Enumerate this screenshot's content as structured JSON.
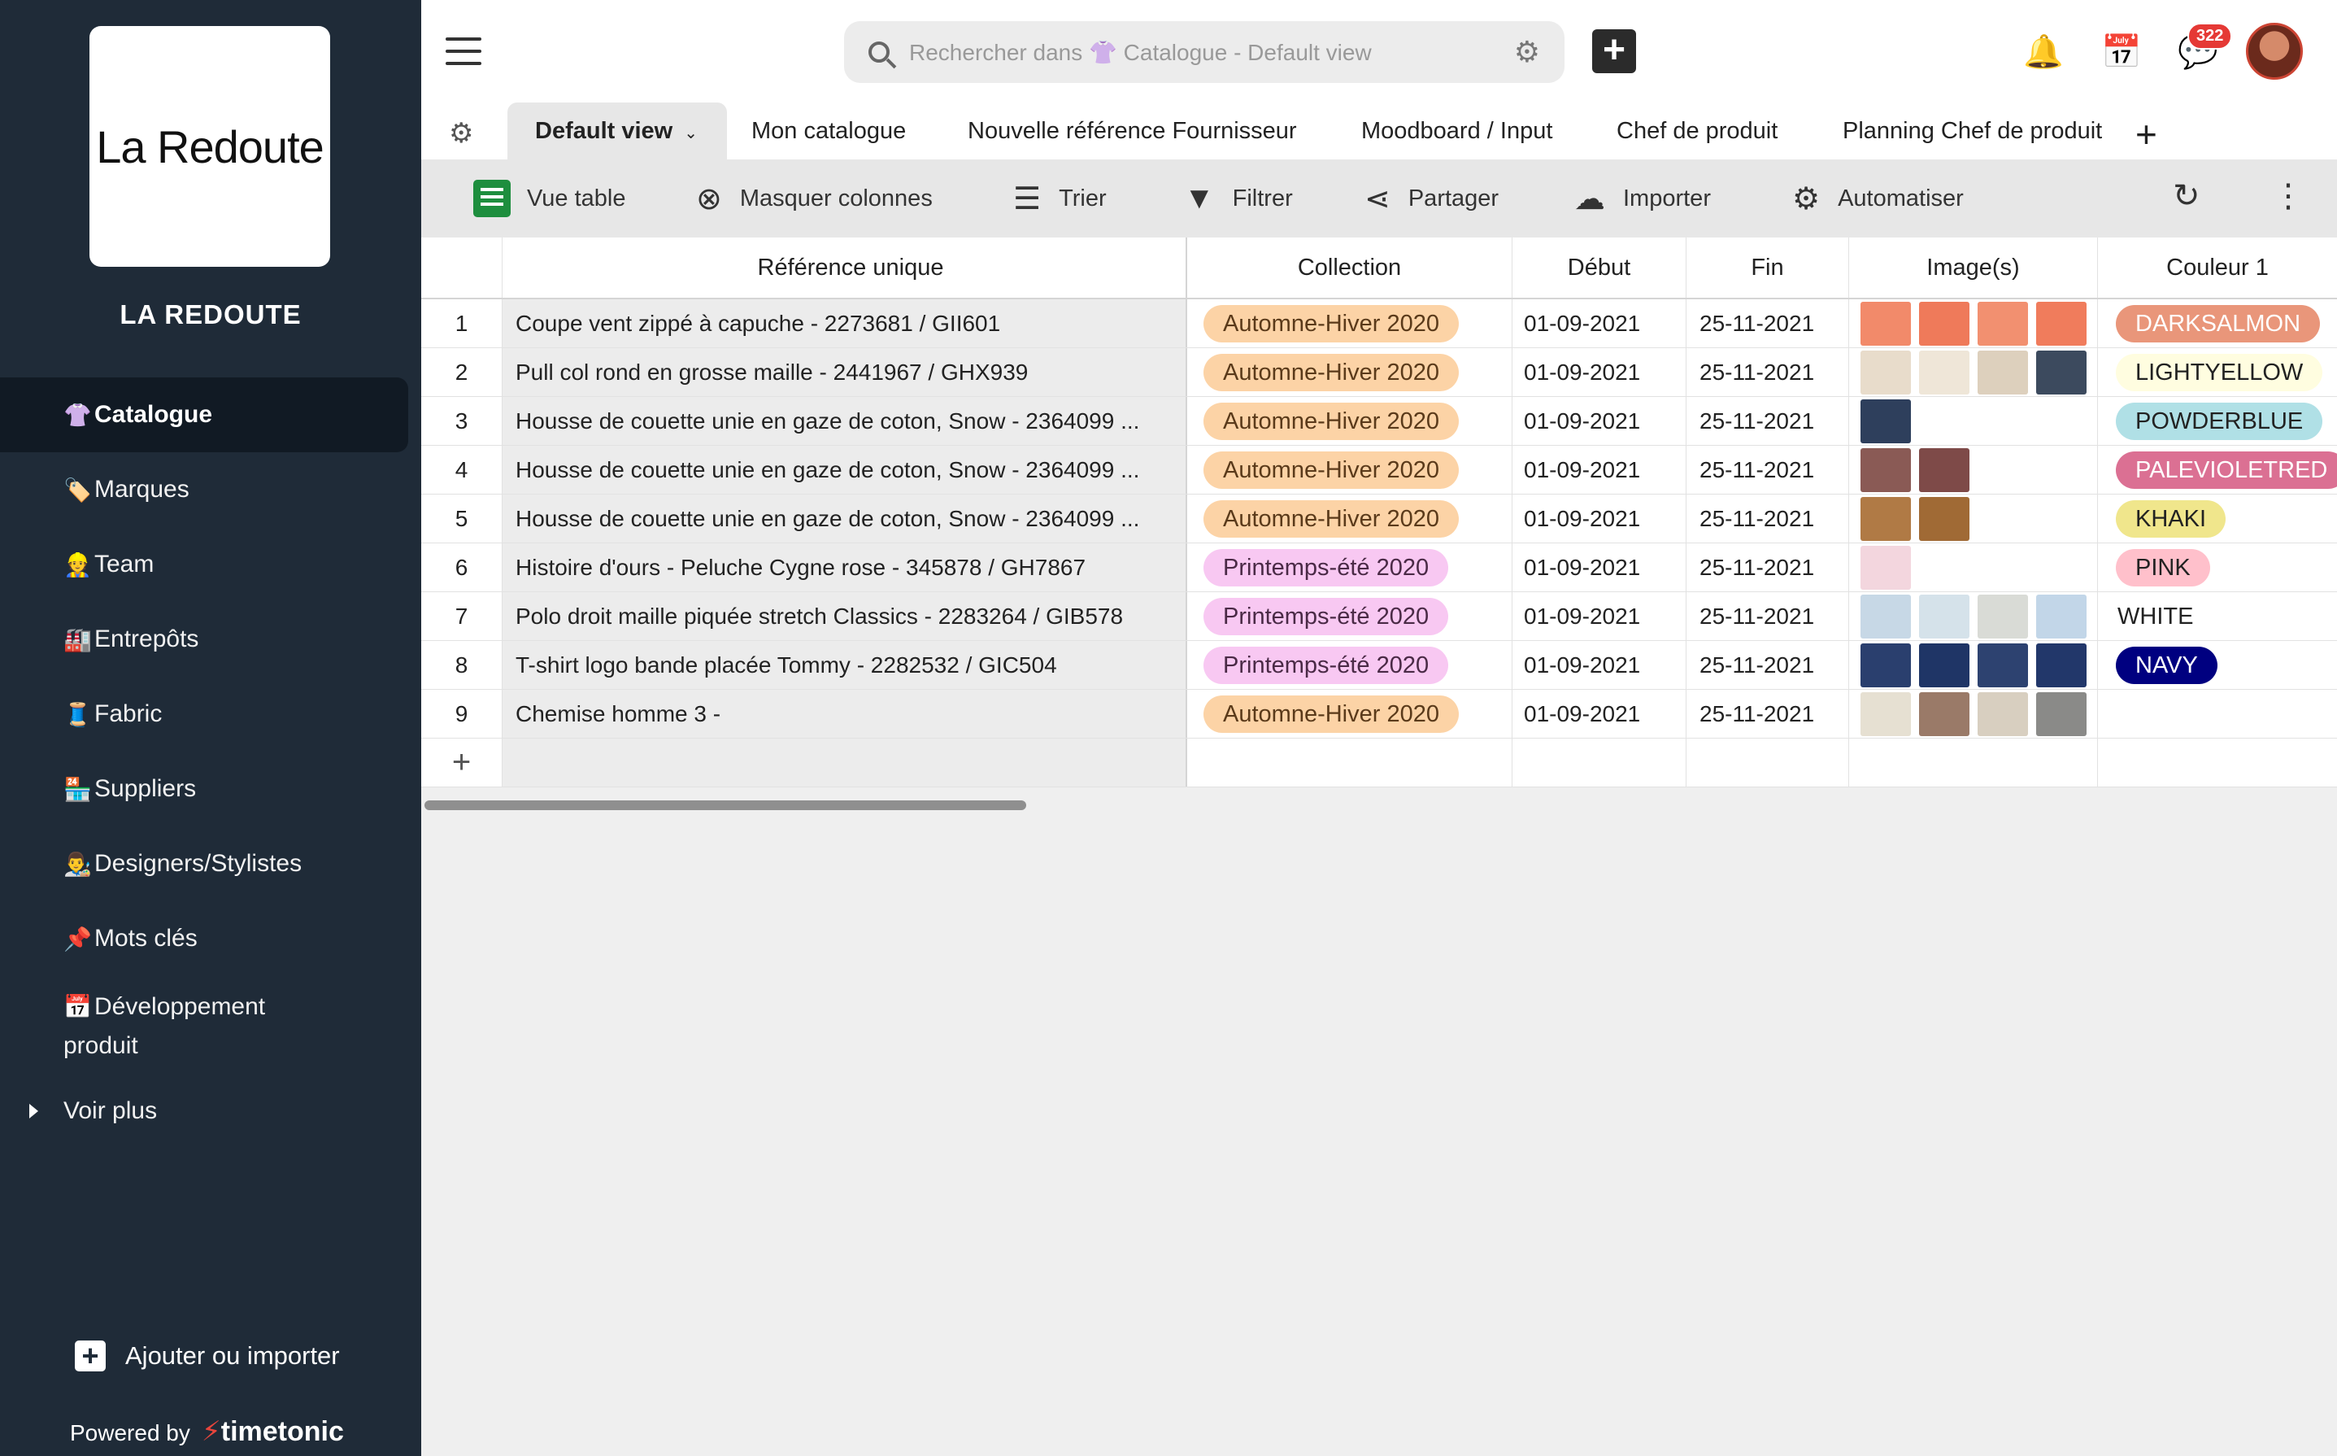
{
  "sidebar": {
    "logo_text": "La Redoute",
    "org_name": "LA REDOUTE",
    "items": [
      {
        "emoji": "👚",
        "label": "Catalogue",
        "active": true
      },
      {
        "emoji": "🏷️",
        "label": "Marques"
      },
      {
        "emoji": "👷",
        "label": "Team"
      },
      {
        "emoji": "🏭",
        "label": "Entrepôts"
      },
      {
        "emoji": "🧵",
        "label": "Fabric"
      },
      {
        "emoji": "🏪",
        "label": "Suppliers"
      },
      {
        "emoji": "👨‍🎨",
        "label": "Designers/Stylistes"
      },
      {
        "emoji": "📌",
        "label": "Mots clés"
      },
      {
        "emoji": "📅",
        "label": "Développement produit"
      }
    ],
    "more_label": "Voir plus",
    "add_import_label": "Ajouter ou importer",
    "powered_by": "Powered by",
    "brand": "timetonic"
  },
  "topbar": {
    "search_placeholder": "Rechercher dans 👚 Catalogue - Default view",
    "notification_count": "322"
  },
  "tabs": [
    {
      "label": "Default view",
      "active": true
    },
    {
      "label": "Mon catalogue"
    },
    {
      "label": "Nouvelle référence Fournisseur"
    },
    {
      "label": "Moodboard / Input"
    },
    {
      "label": "Chef de produit"
    },
    {
      "label": "Planning Chef de produit"
    }
  ],
  "toolbar": {
    "view_table": "Vue table",
    "hide_columns": "Masquer colonnes",
    "sort": "Trier",
    "filter": "Filtrer",
    "share": "Partager",
    "import": "Importer",
    "automate": "Automatiser"
  },
  "table": {
    "columns": {
      "reference": "Référence unique",
      "collection": "Collection",
      "start": "Début",
      "end": "Fin",
      "images": "Image(s)",
      "color1": "Couleur 1"
    },
    "collection_colors": {
      "Automne-Hiver 2020": "#fcd3a6",
      "Printemps-été 2020": "#f8c8f2"
    },
    "rows": [
      {
        "num": "1",
        "reference": "Coupe vent zippé à capuche - 2273681 / GII601",
        "collection": "Automne-Hiver 2020",
        "start": "01-09-2021",
        "end": "25-11-2021",
        "images": [
          "#f28a6a",
          "#ef7a5a",
          "#f29070",
          "#f07c5c"
        ],
        "color": "DARKSALMON",
        "color_bg": "#e9967a",
        "color_fg": "#ffffff"
      },
      {
        "num": "2",
        "reference": "Pull col rond en grosse maille - 2441967 / GHX939",
        "collection": "Automne-Hiver 2020",
        "start": "01-09-2021",
        "end": "25-11-2021",
        "images": [
          "#e8dccb",
          "#efe6d8",
          "#ddd0bd",
          "#3c4a5e"
        ],
        "color": "LIGHTYELLOW",
        "color_bg": "#fffde0",
        "color_fg": "#222222"
      },
      {
        "num": "3",
        "reference": "Housse de couette unie en gaze de coton, Snow - 2364099 ...",
        "collection": "Automne-Hiver 2020",
        "start": "01-09-2021",
        "end": "25-11-2021",
        "images": [
          "#2e3f5c"
        ],
        "color": "POWDERBLUE",
        "color_bg": "#b0e0e6",
        "color_fg": "#222222"
      },
      {
        "num": "4",
        "reference": "Housse de couette unie en gaze de coton, Snow - 2364099 ...",
        "collection": "Automne-Hiver 2020",
        "start": "01-09-2021",
        "end": "25-11-2021",
        "images": [
          "#8a5a55",
          "#7e4a48"
        ],
        "color": "PALEVIOLETRED",
        "color_bg": "#db7093",
        "color_fg": "#ffffff"
      },
      {
        "num": "5",
        "reference": "Housse de couette unie en gaze de coton, Snow - 2364099 ...",
        "collection": "Automne-Hiver 2020",
        "start": "01-09-2021",
        "end": "25-11-2021",
        "images": [
          "#b07a45",
          "#a06a35"
        ],
        "color": "KHAKI",
        "color_bg": "#f0e68c",
        "color_fg": "#222222"
      },
      {
        "num": "6",
        "reference": "Histoire d'ours - Peluche Cygne rose - 345878 / GH7867",
        "collection": "Printemps-été 2020",
        "start": "01-09-2021",
        "end": "25-11-2021",
        "images": [
          "#f3d6de"
        ],
        "color": "PINK",
        "color_bg": "#ffc0cb",
        "color_fg": "#222222"
      },
      {
        "num": "7",
        "reference": "Polo droit maille piquée stretch Classics - 2283264 / GIB578",
        "collection": "Printemps-été 2020",
        "start": "01-09-2021",
        "end": "25-11-2021",
        "images": [
          "#c7d8e6",
          "#d5e2ea",
          "#d9dbd6",
          "#c2d6e8"
        ],
        "color": "WHITE",
        "color_bg": "#ffffff",
        "color_fg": "#222222"
      },
      {
        "num": "8",
        "reference": "T-shirt logo bande placée Tommy - 2282532 / GIC504",
        "collection": "Printemps-été 2020",
        "start": "01-09-2021",
        "end": "25-11-2021",
        "images": [
          "#2a3f6e",
          "#1f3566",
          "#2d4270",
          "#22376a"
        ],
        "color": "NAVY",
        "color_bg": "#000080",
        "color_fg": "#ffffff"
      },
      {
        "num": "9",
        "reference": "Chemise homme 3 -",
        "collection": "Automne-Hiver 2020",
        "start": "01-09-2021",
        "end": "25-11-2021",
        "images": [
          "#e6e0d2",
          "#9a7a68",
          "#d8cfc0",
          "#8a8a88"
        ],
        "color": "",
        "color_bg": "",
        "color_fg": ""
      }
    ]
  }
}
